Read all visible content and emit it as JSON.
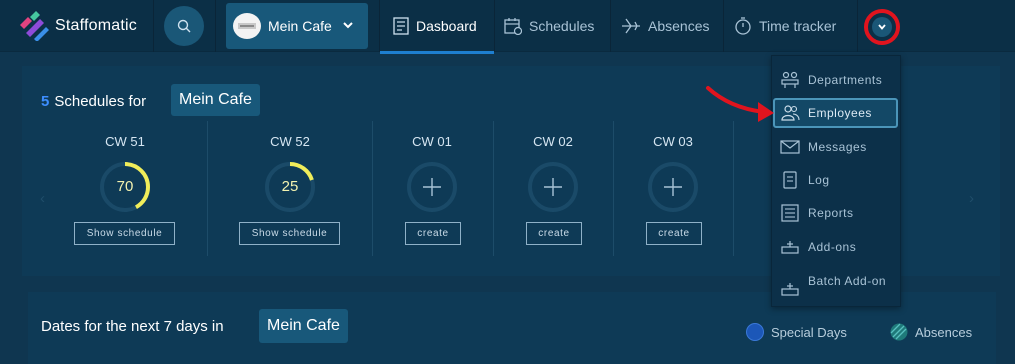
{
  "topbar": {
    "brand": "Staffomatic",
    "company": "Mein Cafe",
    "nav": [
      {
        "label": "Dasboard",
        "icon": "dashboard-icon",
        "active": true
      },
      {
        "label": "Schedules",
        "icon": "calendar-icon",
        "active": false
      },
      {
        "label": "Absences",
        "icon": "airplane-icon",
        "active": false
      },
      {
        "label": "Time tracker",
        "icon": "stopwatch-icon",
        "active": false
      }
    ],
    "more_icon": "chevron-down-icon"
  },
  "schedules": {
    "count": "5",
    "title": "Schedules for",
    "company": "Mein Cafe",
    "weeks": [
      {
        "label": "CW 51",
        "value": "70",
        "progress": 0.42,
        "button": "Show schedule"
      },
      {
        "label": "CW 52",
        "value": "25",
        "progress": 0.2,
        "button": "Show schedule"
      },
      {
        "label": "CW 01",
        "value": "",
        "progress": 0,
        "button": "create"
      },
      {
        "label": "CW 02",
        "value": "",
        "progress": 0,
        "button": "create"
      },
      {
        "label": "CW 03",
        "value": "",
        "progress": 0,
        "button": "create"
      }
    ]
  },
  "dates": {
    "title": "Dates for the next 7 days in",
    "company": "Mein Cafe",
    "legend": [
      {
        "label": "Special Days",
        "color": "#1c57b8"
      },
      {
        "label": "Absences",
        "color": "#2a8f8f"
      }
    ]
  },
  "dropdown": {
    "items": [
      {
        "label": "Departments",
        "icon": "departments-icon"
      },
      {
        "label": "Employees",
        "icon": "employees-icon",
        "highlighted": true
      },
      {
        "label": "Messages",
        "icon": "envelope-icon"
      },
      {
        "label": "Log",
        "icon": "log-icon"
      },
      {
        "label": "Reports",
        "icon": "reports-icon"
      },
      {
        "label": "Add-ons",
        "icon": "addons-icon"
      },
      {
        "label": "Batch Add-on",
        "icon": "batch-addon-icon"
      }
    ]
  },
  "colors": {
    "accent": "#1e7fd0",
    "ring_progress": "#f0ed5a",
    "annotation": "#e0141e"
  }
}
